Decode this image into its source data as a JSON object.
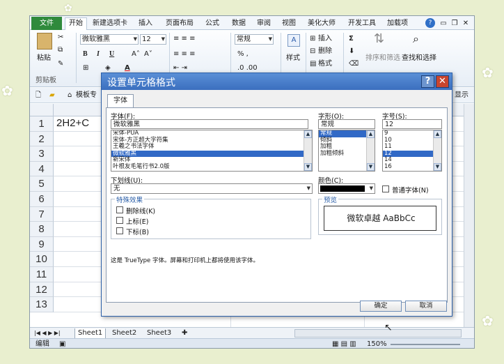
{
  "ribbon": {
    "tabs": [
      "文件",
      "开始",
      "新建选项卡",
      "插入",
      "页面布局",
      "公式",
      "数据",
      "审阅",
      "视图",
      "美化大师",
      "开发工具",
      "加载项"
    ],
    "active_tab": "开始",
    "font_name": "微软雅黑",
    "font_size": "12",
    "paste_label": "粘贴",
    "clipboard_label": "剪贴板",
    "number_format": "常规",
    "style_label": "样式",
    "insert_label": "插入",
    "delete_label": "删除",
    "format_label": "格式",
    "sort_filter_label": "排序和筛选",
    "find_select_label": "查找和选择",
    "display_label": "显示",
    "template_label": "模板专"
  },
  "sheet": {
    "cell_a1": "2H2+C",
    "rows": [
      "1",
      "2",
      "3",
      "4",
      "5",
      "6",
      "7",
      "8",
      "9",
      "10",
      "11",
      "12",
      "13"
    ],
    "tabs": [
      "Sheet1",
      "Sheet2",
      "Sheet3"
    ]
  },
  "status": {
    "mode": "编辑",
    "zoom": "150%"
  },
  "dialog": {
    "title": "设置单元格格式",
    "tab_font": "字体",
    "font_label": "字体(F):",
    "style_label": "字形(O):",
    "size_label": "字号(S):",
    "font_value": "微软雅黑",
    "style_value": "常规",
    "size_value": "12",
    "font_list": [
      "宋体-PUA",
      "宋体-方正超大字符集",
      "王羲之书法字体",
      "微软雅黑",
      "新宋体",
      "叶根友毛笔行书2.0版"
    ],
    "style_list": [
      "常规",
      "倾斜",
      "加粗",
      "加粗倾斜"
    ],
    "size_list": [
      "9",
      "10",
      "11",
      "12",
      "14",
      "16"
    ],
    "underline_label": "下划线(U):",
    "underline_value": "无",
    "color_label": "颜色(C):",
    "normal_font_label": "普通字体(N)",
    "effects_label": "特殊效果",
    "strike_label": "删除线(K)",
    "super_label": "上标(E)",
    "sub_label": "下标(B)",
    "preview_label": "预览",
    "preview_text": "微软卓越  AaBbCc",
    "note": "这是 TrueType 字体。屏幕和打印机上都将使用该字体。",
    "ok": "确定",
    "cancel": "取消"
  }
}
